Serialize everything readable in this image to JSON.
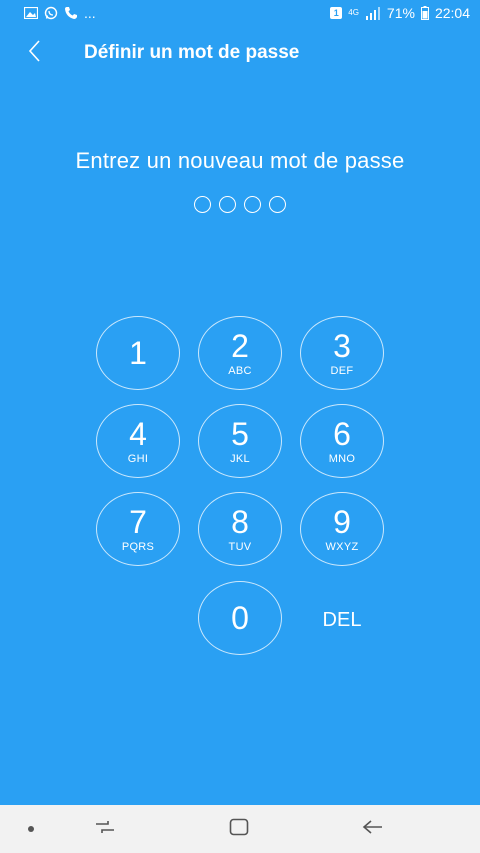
{
  "status_bar": {
    "left_icons": [
      "image-notification-icon",
      "whatsapp-icon",
      "phone-call-icon"
    ],
    "more_label": "...",
    "sim_badge": "1",
    "network": "4G",
    "battery_percent": "71%",
    "time": "22:04"
  },
  "header": {
    "title": "Définir un mot de passe"
  },
  "prompt": {
    "text": "Entrez un nouveau mot de passe",
    "pin_length": 4
  },
  "keypad": {
    "keys": [
      {
        "digit": "1",
        "letters": ""
      },
      {
        "digit": "2",
        "letters": "ABC"
      },
      {
        "digit": "3",
        "letters": "DEF"
      },
      {
        "digit": "4",
        "letters": "GHI"
      },
      {
        "digit": "5",
        "letters": "JKL"
      },
      {
        "digit": "6",
        "letters": "MNO"
      },
      {
        "digit": "7",
        "letters": "PQRS"
      },
      {
        "digit": "8",
        "letters": "TUV"
      },
      {
        "digit": "9",
        "letters": "WXYZ"
      },
      {
        "digit": "0",
        "letters": ""
      }
    ],
    "delete_label": "DEL"
  },
  "colors": {
    "background": "#2aa0f3",
    "nav_bar": "#f2f2f2",
    "nav_icon": "#555555"
  }
}
